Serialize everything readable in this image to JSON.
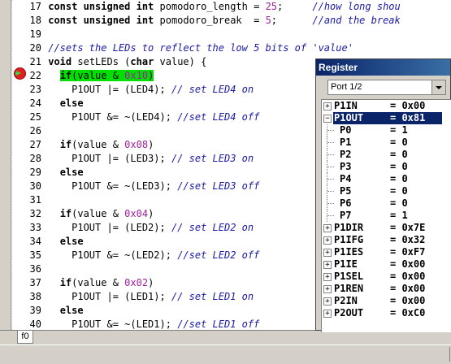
{
  "editor": {
    "lines": [
      {
        "n": "17",
        "parts": [
          {
            "t": "const unsigned int",
            "c": "kw"
          },
          {
            "t": " pomodoro_length = ",
            "c": ""
          },
          {
            "t": "25",
            "c": "num"
          },
          {
            "t": ";     ",
            "c": ""
          },
          {
            "t": "//how long shou",
            "c": "cm"
          }
        ]
      },
      {
        "n": "18",
        "parts": [
          {
            "t": "const unsigned int",
            "c": "kw"
          },
          {
            "t": " pomodoro_break  = ",
            "c": ""
          },
          {
            "t": "5",
            "c": "num"
          },
          {
            "t": ";      ",
            "c": ""
          },
          {
            "t": "//and the break",
            "c": "cm"
          }
        ]
      },
      {
        "n": "19",
        "parts": []
      },
      {
        "n": "20",
        "parts": [
          {
            "t": "//sets the LEDs to reflect the low 5 bits of 'value'",
            "c": "cm"
          }
        ]
      },
      {
        "n": "21",
        "parts": [
          {
            "t": "void",
            "c": "kw"
          },
          {
            "t": " setLEDs (",
            "c": ""
          },
          {
            "t": "char",
            "c": "kw"
          },
          {
            "t": " value) {",
            "c": ""
          }
        ]
      },
      {
        "n": "22",
        "parts": [
          {
            "t": "  ",
            "c": ""
          },
          {
            "t": "if",
            "c": "kw hl"
          },
          {
            "t": "(value & ",
            "c": "hl"
          },
          {
            "t": "0x10",
            "c": "num hl"
          },
          {
            "t": ")",
            "c": "hl"
          }
        ]
      },
      {
        "n": "23",
        "parts": [
          {
            "t": "    P1OUT |= (LED4); ",
            "c": ""
          },
          {
            "t": "// set LED4 on",
            "c": "cm"
          }
        ]
      },
      {
        "n": "24",
        "parts": [
          {
            "t": "  ",
            "c": ""
          },
          {
            "t": "else",
            "c": "kw"
          }
        ]
      },
      {
        "n": "25",
        "parts": [
          {
            "t": "    P1OUT &= ~(LED4); ",
            "c": ""
          },
          {
            "t": "//set LED4 off",
            "c": "cm"
          }
        ]
      },
      {
        "n": "26",
        "parts": []
      },
      {
        "n": "27",
        "parts": [
          {
            "t": "  ",
            "c": ""
          },
          {
            "t": "if",
            "c": "kw"
          },
          {
            "t": "(value & ",
            "c": ""
          },
          {
            "t": "0x08",
            "c": "num"
          },
          {
            "t": ")",
            "c": ""
          }
        ]
      },
      {
        "n": "28",
        "parts": [
          {
            "t": "    P1OUT |= (LED3); ",
            "c": ""
          },
          {
            "t": "// set LED3 on",
            "c": "cm"
          }
        ]
      },
      {
        "n": "29",
        "parts": [
          {
            "t": "  ",
            "c": ""
          },
          {
            "t": "else",
            "c": "kw"
          }
        ]
      },
      {
        "n": "30",
        "parts": [
          {
            "t": "    P1OUT &= ~(LED3); ",
            "c": ""
          },
          {
            "t": "//set LED3 off",
            "c": "cm"
          }
        ]
      },
      {
        "n": "31",
        "parts": []
      },
      {
        "n": "32",
        "parts": [
          {
            "t": "  ",
            "c": ""
          },
          {
            "t": "if",
            "c": "kw"
          },
          {
            "t": "(value & ",
            "c": ""
          },
          {
            "t": "0x04",
            "c": "num"
          },
          {
            "t": ")",
            "c": ""
          }
        ]
      },
      {
        "n": "33",
        "parts": [
          {
            "t": "    P1OUT |= (LED2); ",
            "c": ""
          },
          {
            "t": "// set LED2 on",
            "c": "cm"
          }
        ]
      },
      {
        "n": "34",
        "parts": [
          {
            "t": "  ",
            "c": ""
          },
          {
            "t": "else",
            "c": "kw"
          }
        ]
      },
      {
        "n": "35",
        "parts": [
          {
            "t": "    P1OUT &= ~(LED2); ",
            "c": ""
          },
          {
            "t": "//set LED2 off",
            "c": "cm"
          }
        ]
      },
      {
        "n": "36",
        "parts": []
      },
      {
        "n": "37",
        "parts": [
          {
            "t": "  ",
            "c": ""
          },
          {
            "t": "if",
            "c": "kw"
          },
          {
            "t": "(value & ",
            "c": ""
          },
          {
            "t": "0x02",
            "c": "num"
          },
          {
            "t": ")",
            "c": ""
          }
        ]
      },
      {
        "n": "38",
        "parts": [
          {
            "t": "    P1OUT |= (LED1); ",
            "c": ""
          },
          {
            "t": "// set LED1 on",
            "c": "cm"
          }
        ]
      },
      {
        "n": "39",
        "parts": [
          {
            "t": "  ",
            "c": ""
          },
          {
            "t": "else",
            "c": "kw"
          }
        ]
      },
      {
        "n": "40",
        "parts": [
          {
            "t": "    P1OUT &= ~(LED1); ",
            "c": ""
          },
          {
            "t": "//set LED1 off",
            "c": "cm"
          }
        ]
      }
    ]
  },
  "tab": {
    "label": "f0"
  },
  "register_window": {
    "title": "Register",
    "selected_group": "Port 1/2",
    "rows": [
      {
        "name": "P1IN",
        "value": "= 0x00",
        "expanded": false,
        "child": false,
        "selected": false
      },
      {
        "name": "P1OUT",
        "value": "= 0x81",
        "expanded": true,
        "child": false,
        "selected": true
      },
      {
        "name": "P0",
        "value": "= 1",
        "child": true
      },
      {
        "name": "P1",
        "value": "= 0",
        "child": true
      },
      {
        "name": "P2",
        "value": "= 0",
        "child": true
      },
      {
        "name": "P3",
        "value": "= 0",
        "child": true
      },
      {
        "name": "P4",
        "value": "= 0",
        "child": true
      },
      {
        "name": "P5",
        "value": "= 0",
        "child": true
      },
      {
        "name": "P6",
        "value": "= 0",
        "child": true
      },
      {
        "name": "P7",
        "value": "= 1",
        "child": true
      },
      {
        "name": "P1DIR",
        "value": "= 0x7E",
        "expanded": false,
        "child": false
      },
      {
        "name": "P1IFG",
        "value": "= 0x32",
        "expanded": false,
        "child": false
      },
      {
        "name": "P1IES",
        "value": "= 0xF7",
        "expanded": false,
        "child": false
      },
      {
        "name": "P1IE",
        "value": "= 0x00",
        "expanded": false,
        "child": false
      },
      {
        "name": "P1SEL",
        "value": "= 0x00",
        "expanded": false,
        "child": false
      },
      {
        "name": "P1REN",
        "value": "= 0x00",
        "expanded": false,
        "child": false
      },
      {
        "name": "P2IN",
        "value": "= 0x00",
        "expanded": false,
        "child": false
      },
      {
        "name": "P2OUT",
        "value": "= 0xC0",
        "expanded": false,
        "child": false
      }
    ]
  }
}
